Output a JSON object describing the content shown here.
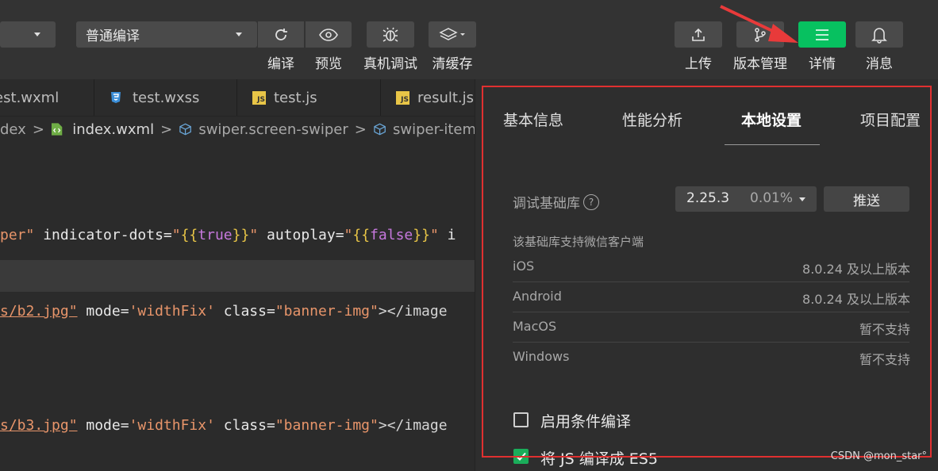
{
  "toolbar": {
    "compile_mode": "普通编译",
    "left_buttons": [
      {
        "name": "compile",
        "label": "编译",
        "icon": "refresh-icon"
      },
      {
        "name": "preview",
        "label": "预览",
        "icon": "eye-icon"
      },
      {
        "name": "remote-debug",
        "label": "真机调试",
        "icon": "bug-icon"
      },
      {
        "name": "clear-cache",
        "label": "清缓存",
        "icon": "layers-icon"
      }
    ],
    "right_buttons": [
      {
        "name": "upload",
        "label": "上传",
        "icon": "upload-icon"
      },
      {
        "name": "version",
        "label": "版本管理",
        "icon": "branch-icon"
      },
      {
        "name": "details",
        "label": "详情",
        "icon": "menu-icon"
      },
      {
        "name": "messages",
        "label": "消息",
        "icon": "bell-icon"
      }
    ],
    "active_color": "#07c160",
    "annotation_arrow_color": "#e83a3a"
  },
  "editor": {
    "tabs": [
      {
        "label": "test.wxml",
        "icon": "none"
      },
      {
        "label": "test.wxss",
        "icon": "css-icon"
      },
      {
        "label": "test.js",
        "icon": "js-icon"
      },
      {
        "label": "result.js",
        "icon": "js-icon"
      }
    ],
    "js_badge": "JS",
    "breadcrumb": {
      "part1": "dex",
      "sep": ">",
      "file": "index.wxml",
      "node1": "swiper.screen-swiper",
      "node2": "swiper-item"
    },
    "lines": {
      "l1": {
        "a": "per\"",
        "b": " indicator-dots=",
        "c": "\"",
        "d": "{{",
        "e": "true",
        "f": "}}",
        "g": "\"",
        "h": " autoplay=",
        "i": "\"",
        "j": "{{",
        "k": "false",
        "l": "}}",
        "m": "\"",
        "n": " i"
      },
      "l2": {
        "a": "s/b2.jpg\"",
        "b": " mode=",
        "c": "'widthFix'",
        "d": " class=",
        "e": "\"banner-img\"",
        "f": "></image"
      },
      "l3": {
        "a": "s/b3.jpg\"",
        "b": " mode=",
        "c": "'widthFix'",
        "d": " class=",
        "e": "\"banner-img\"",
        "f": "></image"
      }
    }
  },
  "panel": {
    "tabs": [
      "基本信息",
      "性能分析",
      "本地设置",
      "项目配置"
    ],
    "active_tab": "本地设置",
    "debug_lib": {
      "label": "调试基础库",
      "help": "?",
      "version": "2.25.3",
      "percent": "0.01%",
      "push": "推送"
    },
    "support_title": "该基础库支持微信客户端",
    "support_rows": [
      {
        "os": "iOS",
        "value": "8.0.24 及以上版本"
      },
      {
        "os": "Android",
        "value": "8.0.24 及以上版本"
      },
      {
        "os": "MacOS",
        "value": "暂不支持"
      },
      {
        "os": "Windows",
        "value": "暂不支持"
      }
    ],
    "options": [
      {
        "label": "启用条件编译",
        "checked": false
      },
      {
        "label": "将 JS 编译成 ES5",
        "checked": true
      }
    ],
    "highlight_color": "#e03030"
  },
  "watermark": "CSDN @mon_star°"
}
